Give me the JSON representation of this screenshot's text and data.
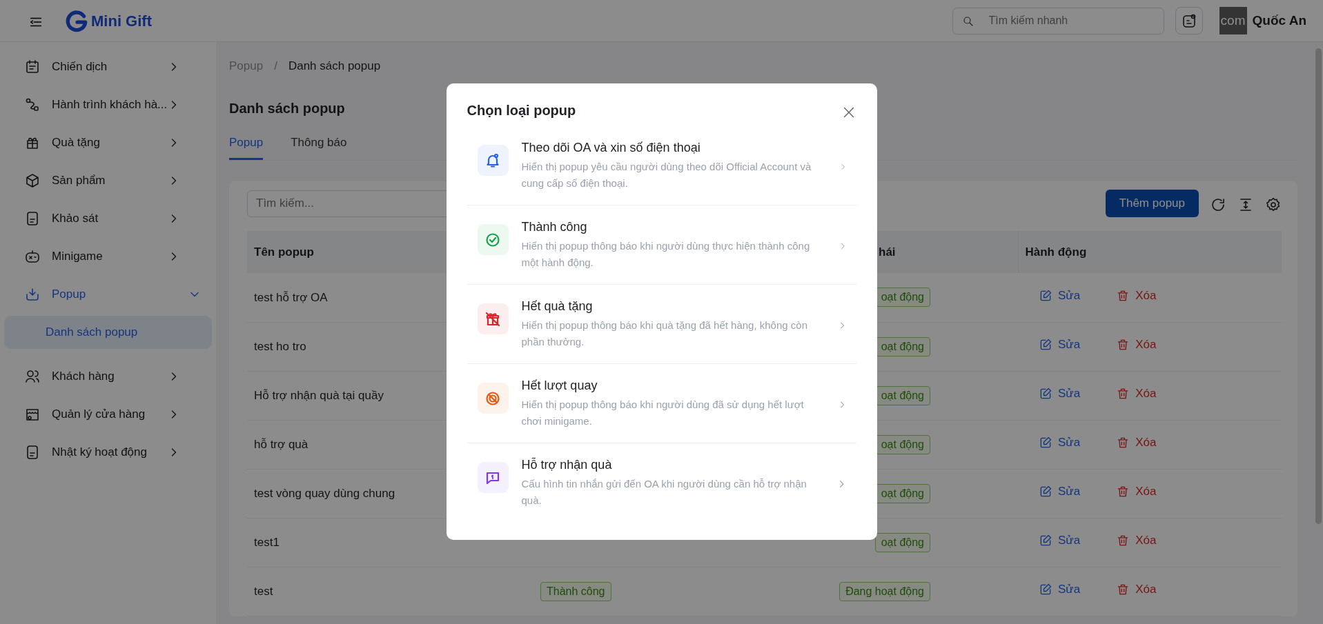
{
  "header": {
    "logo": "Mini Gift",
    "search": {
      "placeholder": "Tìm kiếm nhanh"
    },
    "avatar_text": "com",
    "user_name": "Quốc An"
  },
  "sidebar": {
    "items": [
      {
        "label": "Chiến dịch",
        "expanded": false,
        "selected": false
      },
      {
        "label": "Hành trình khách hà...",
        "expanded": false,
        "selected": false
      },
      {
        "label": "Quà tặng",
        "expanded": false,
        "selected": false
      },
      {
        "label": "Sản phẩm",
        "expanded": false,
        "selected": false
      },
      {
        "label": "Khảo sát",
        "expanded": false,
        "selected": false
      },
      {
        "label": "Minigame",
        "expanded": false,
        "selected": false
      },
      {
        "label": "Popup",
        "expanded": true,
        "selected": true,
        "children": [
          {
            "label": "Danh sách popup",
            "selected": true
          }
        ]
      },
      {
        "label": "Khách hàng",
        "expanded": false,
        "selected": false
      },
      {
        "label": "Quản lý cửa hàng",
        "expanded": false,
        "selected": false
      },
      {
        "label": "Nhật ký hoạt động",
        "expanded": false,
        "selected": false
      }
    ]
  },
  "breadcrumb": [
    "Popup",
    "Danh sách popup"
  ],
  "breadcrumb_separator": "/",
  "page_title": "Danh sách popup",
  "tabs": [
    {
      "label": "Popup",
      "selected": true
    },
    {
      "label": "Thông báo",
      "selected": false
    }
  ],
  "toolbar": {
    "search": {
      "placeholder": "Tìm kiếm..."
    },
    "add_button": "Thêm popup"
  },
  "table": {
    "columns": [
      "Tên popup",
      "hái",
      "Hành động"
    ],
    "rows": [
      {
        "name": "test hỗ trợ OA",
        "status": "oạt động",
        "edit": "Sửa",
        "delete": "Xóa"
      },
      {
        "name": "test ho tro",
        "status": "oạt động",
        "edit": "Sửa",
        "delete": "Xóa"
      },
      {
        "name": "Hỗ trợ nhận quà tại quầy",
        "status": "oạt động",
        "edit": "Sửa",
        "delete": "Xóa"
      },
      {
        "name": "hỗ trợ quà",
        "status": "oạt động",
        "edit": "Sửa",
        "delete": "Xóa"
      },
      {
        "name": "test vòng quay dùng chung",
        "status": "oạt động",
        "edit": "Sửa",
        "delete": "Xóa"
      },
      {
        "name": "test1",
        "status": "oạt động",
        "edit": "Sửa",
        "delete": "Xóa"
      },
      {
        "name": "test",
        "type": "Thành công",
        "status": "Đang hoạt động",
        "edit": "Sửa",
        "delete": "Xóa"
      }
    ]
  },
  "modal": {
    "title": "Chọn loại popup",
    "options": [
      {
        "title": "Theo dõi OA và xin số điện thoại",
        "description": "Hiển thị popup yêu cầu người dùng theo dõi Official Account và cung cấp số điện thoại.",
        "color": "#2563eb"
      },
      {
        "title": "Thành công",
        "description": "Hiển thị popup thông báo khi người dùng thực hiện thành công một hành động.",
        "color": "#16a34a"
      },
      {
        "title": "Hết quà tặng",
        "description": "Hiển thị popup thông báo khi quà tặng đã hết hàng, không còn phần thưởng.",
        "color": "#dc2626"
      },
      {
        "title": "Hết lượt quay",
        "description": "Hiển thị popup thông báo khi người dùng đã sử dụng hết lượt chơi minigame.",
        "color": "#ea580c"
      },
      {
        "title": "Hỗ trợ nhận quà",
        "description": "Cấu hình tin nhắn gửi đến OA khi người dùng cần hỗ trợ nhận quà.",
        "color": "#7c3aed"
      }
    ]
  }
}
